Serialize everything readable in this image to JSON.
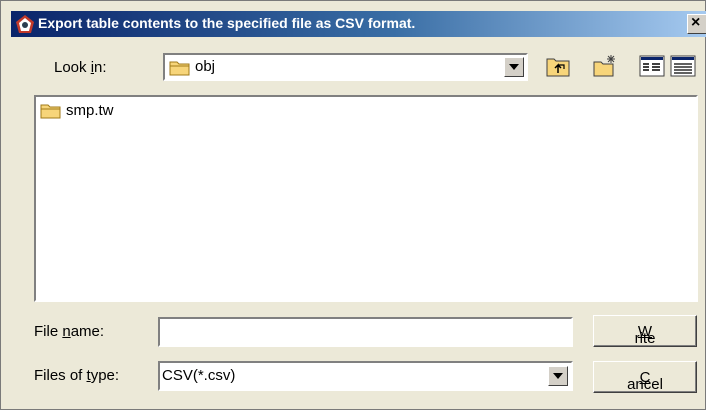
{
  "window": {
    "title": "Export table contents to the specified file as CSV format.",
    "close_glyph": "×"
  },
  "lookin": {
    "label_pre": "Look ",
    "label_mnemonic": "i",
    "label_post": "n:",
    "value": "obj",
    "icon": "folder-icon"
  },
  "toolbar": {
    "icons": [
      "up-one-level-icon",
      "new-folder-icon",
      "list-view-icon",
      "details-view-icon"
    ]
  },
  "files": [
    {
      "name": "smp.tw",
      "icon": "folder-icon"
    }
  ],
  "filename": {
    "label_pre": "File ",
    "label_mnemonic": "n",
    "label_post": "ame:",
    "value": ""
  },
  "filetype": {
    "label_pre": "Files of ",
    "label_mnemonic": "t",
    "label_post": "ype:",
    "value": "CSV(*.csv)"
  },
  "buttons": {
    "write_mnemonic": "W",
    "write_rest": "rite",
    "cancel_mnemonic": "C",
    "cancel_rest": "ancel"
  }
}
